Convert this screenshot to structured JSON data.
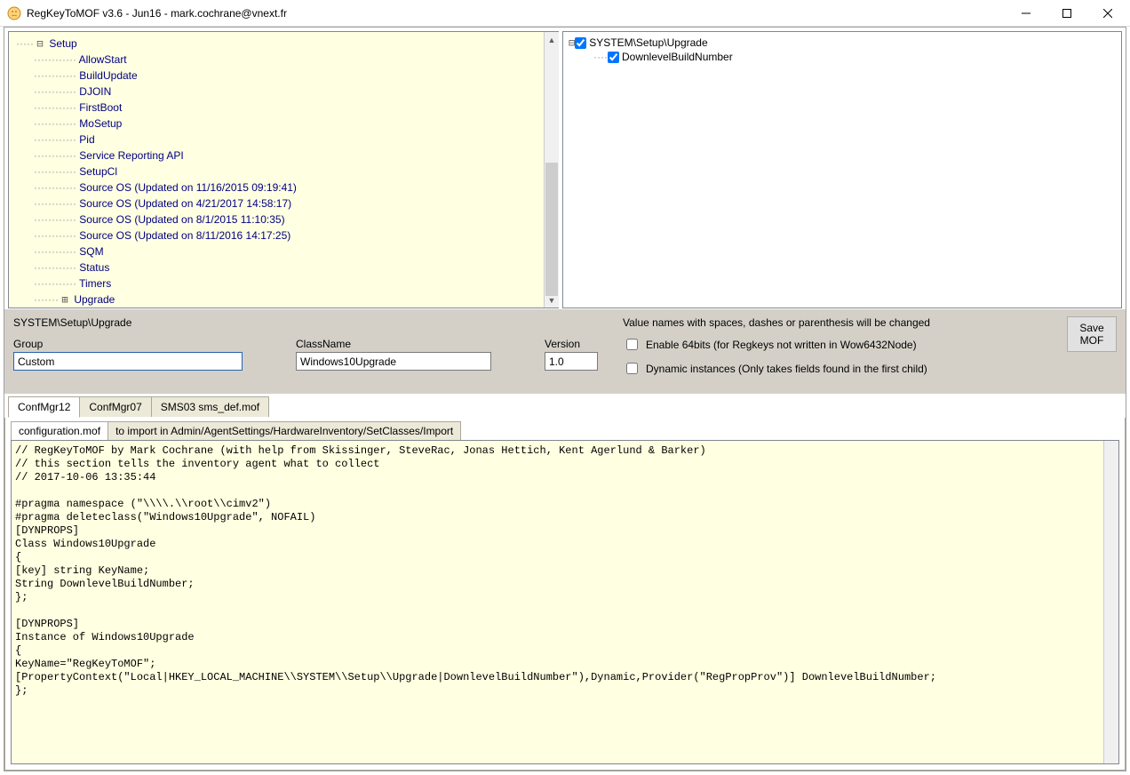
{
  "window": {
    "title": "RegKeyToMOF v3.6 - Jun16 - mark.cochrane@vnext.fr"
  },
  "tree": {
    "root": "Setup",
    "items": [
      "AllowStart",
      "BuildUpdate",
      "DJOIN",
      "FirstBoot",
      "MoSetup",
      "Pid",
      "Service Reporting API",
      "SetupCl",
      "Source OS (Updated on 11/16/2015 09:19:41)",
      "Source OS (Updated on 4/21/2017 14:58:17)",
      "Source OS (Updated on 8/1/2015 11:10:35)",
      "Source OS (Updated on 8/11/2016 14:17:25)",
      "SQM",
      "Status",
      "Timers"
    ],
    "last_expandable": "Upgrade"
  },
  "right_tree": {
    "root": "SYSTEM\\Setup\\Upgrade",
    "child": "DownlevelBuildNumber"
  },
  "mid": {
    "path": "SYSTEM\\Setup\\Upgrade",
    "group_label": "Group",
    "group_value": "Custom",
    "classname_label": "ClassName",
    "classname_value": "Windows10Upgrade",
    "version_label": "Version",
    "version_value": "1.0",
    "note": "Value names with spaces, dashes or parenthesis will be changed",
    "chk1": "Enable 64bits (for Regkeys not written in Wow6432Node)",
    "chk2": "Dynamic instances (Only takes fields found in the first child)",
    "save_line1": "Save",
    "save_line2": "MOF"
  },
  "tabs": {
    "level1": [
      "ConfMgr12",
      "ConfMgr07",
      "SMS03 sms_def.mof"
    ],
    "level2": [
      "configuration.mof",
      "to import in Admin/AgentSettings/HardwareInventory/SetClasses/Import"
    ]
  },
  "code": "// RegKeyToMOF by Mark Cochrane (with help from Skissinger, SteveRac, Jonas Hettich, Kent Agerlund & Barker)\n// this section tells the inventory agent what to collect\n// 2017-10-06 13:35:44\n\n#pragma namespace (\"\\\\\\\\.\\\\root\\\\cimv2\")\n#pragma deleteclass(\"Windows10Upgrade\", NOFAIL)\n[DYNPROPS]\nClass Windows10Upgrade\n{\n[key] string KeyName;\nString DownlevelBuildNumber;\n};\n\n[DYNPROPS]\nInstance of Windows10Upgrade\n{\nKeyName=\"RegKeyToMOF\";\n[PropertyContext(\"Local|HKEY_LOCAL_MACHINE\\\\SYSTEM\\\\Setup\\\\Upgrade|DownlevelBuildNumber\"),Dynamic,Provider(\"RegPropProv\")] DownlevelBuildNumber;\n};\n"
}
